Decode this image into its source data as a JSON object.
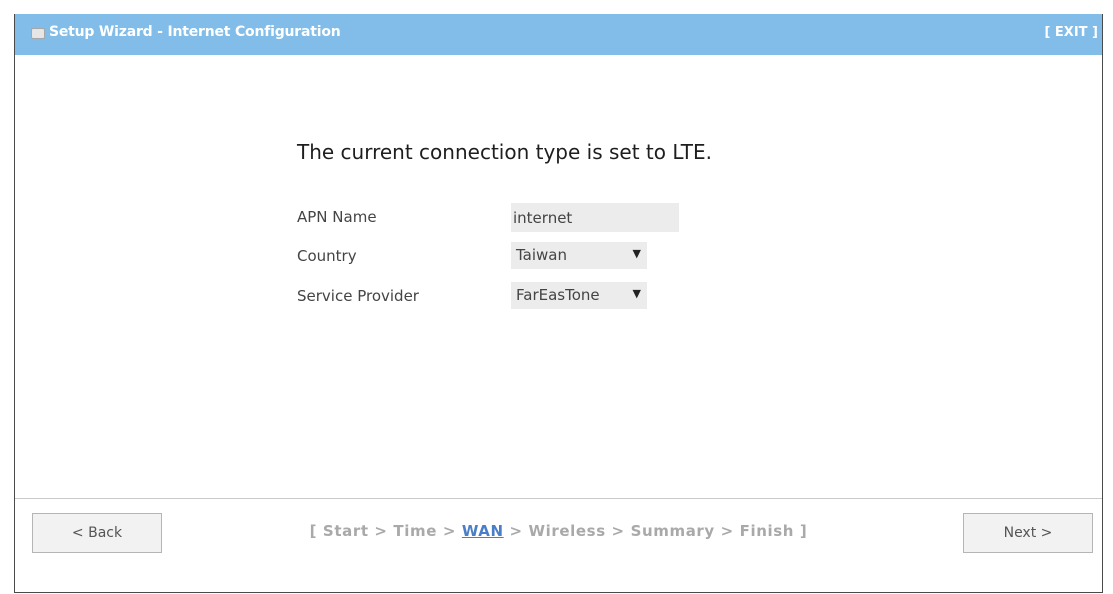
{
  "window": {
    "title": "Setup Wizard - Internet Configuration",
    "exit_label": "[ EXIT ]",
    "title_bar_color": "#81bde8"
  },
  "main": {
    "heading": "The current connection type is set to LTE.",
    "fields": {
      "apn": {
        "label": "APN Name",
        "value": "internet"
      },
      "country": {
        "label": "Country",
        "value": "Taiwan"
      },
      "provider": {
        "label": "Service Provider",
        "value": "FarEasTone"
      }
    }
  },
  "footer": {
    "back_label": "< Back",
    "next_label": "Next >",
    "progress": {
      "open": "[ ",
      "steps": [
        "Start",
        "Time",
        "WAN",
        "Wireless",
        "Summary",
        "Finish"
      ],
      "separator": " > ",
      "close": " ]",
      "current_index": 2,
      "current_color": "#4a7ec8"
    }
  },
  "icons": {
    "window_icon": "window-icon",
    "dropdown_arrow": "chevron-down-icon"
  }
}
